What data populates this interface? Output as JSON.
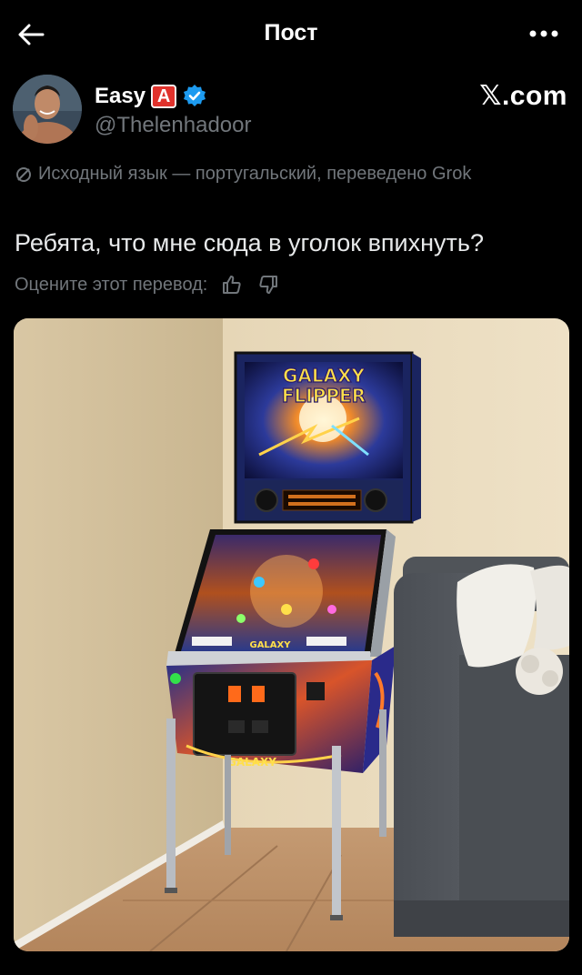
{
  "header": {
    "title": "Пост",
    "back_icon": "arrow-left-icon",
    "more_icon": "more-horizontal-icon"
  },
  "author": {
    "display_name": "Easy",
    "badge_letter": "A",
    "handle": "@Thelenhadoor",
    "verified_icon": "verified-badge-icon",
    "verified_color": "#1d9bf0"
  },
  "source_label": "𝕏.com",
  "translation_note": "Исходный язык — португальский, переведено Grok",
  "post_text": "Ребята, что мне сюда в уголок впихнуть?",
  "rate_translation": {
    "label": "Оцените этот перевод:",
    "like_icon": "thumbs-up-icon",
    "dislike_icon": "thumbs-down-icon"
  },
  "media": {
    "marquee_title_line1": "GALAXY",
    "marquee_title_line2": "FLIPPER",
    "apron_text": "GALAXY"
  }
}
